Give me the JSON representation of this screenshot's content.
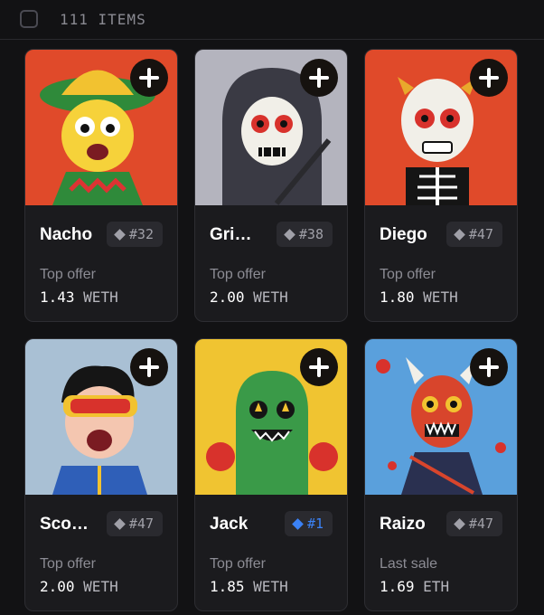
{
  "header": {
    "count": "111 ITEMS"
  },
  "items": [
    {
      "name": "Nacho",
      "rank": "#32",
      "price_label": "Top offer",
      "price": "1.43",
      "currency": "WETH",
      "bg": "#e04a2a"
    },
    {
      "name": "Gri…",
      "rank": "#38",
      "price_label": "Top offer",
      "price": "2.00",
      "currency": "WETH",
      "bg": "#b4b4be"
    },
    {
      "name": "Diego",
      "rank": "#47",
      "price_label": "Top offer",
      "price": "1.80",
      "currency": "WETH",
      "bg": "#e04a2a"
    },
    {
      "name": "Sco…",
      "rank": "#47",
      "price_label": "Top offer",
      "price": "2.00",
      "currency": "WETH",
      "bg": "#a9c0d4"
    },
    {
      "name": "Jack",
      "rank": "#1",
      "rank_color": "#3b82f6",
      "price_label": "Top offer",
      "price": "1.85",
      "currency": "WETH",
      "bg": "#f0c431"
    },
    {
      "name": "Raizo",
      "rank": "#47",
      "price_label": "Last sale",
      "price": "1.69",
      "currency": "ETH",
      "bg": "#5aa0dc"
    }
  ]
}
